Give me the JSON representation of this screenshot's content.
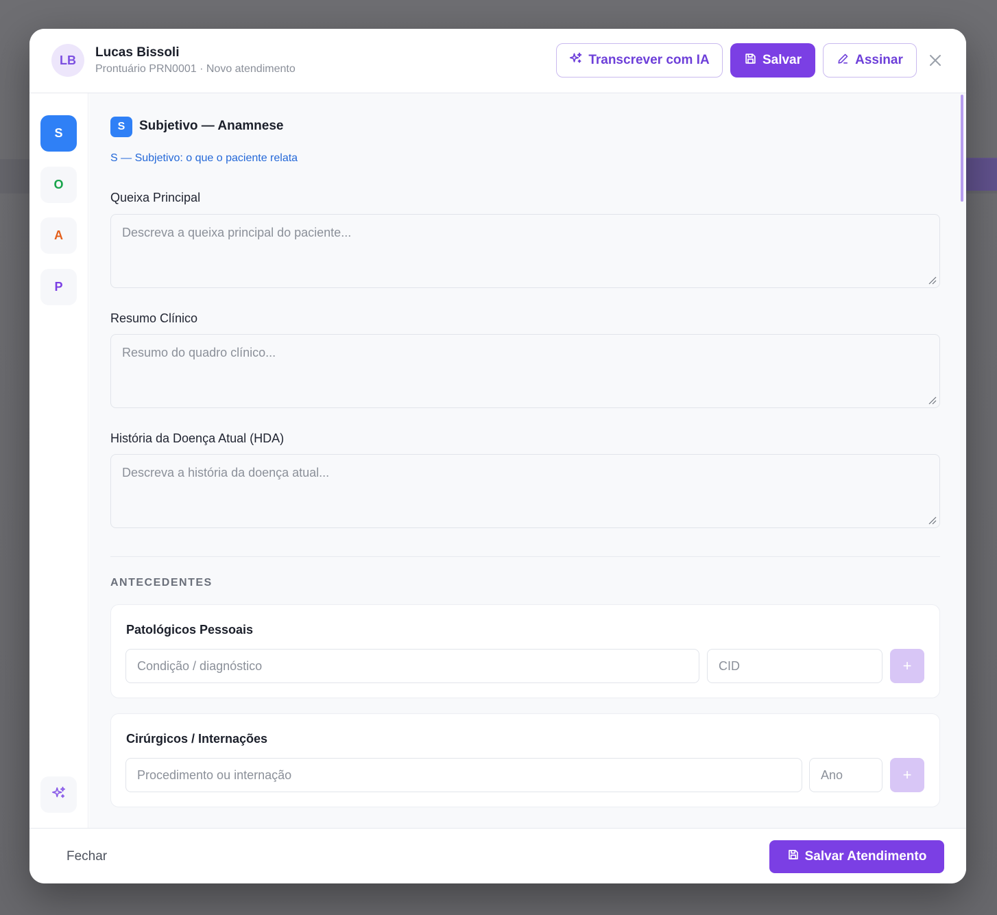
{
  "header": {
    "avatar_initials": "LB",
    "patient_name": "Lucas Bissoli",
    "record_id": "Prontuário PRN0001",
    "separator": " · ",
    "visit_type": "Novo atendimento",
    "transcribe_label": "Transcrever com IA",
    "save_label": "Salvar",
    "sign_label": "Assinar",
    "close_icon": "close-icon"
  },
  "sidebar": {
    "items": [
      {
        "label": "S",
        "color": "#2f80f6",
        "active": true
      },
      {
        "label": "O",
        "color": "#18a44b",
        "active": false
      },
      {
        "label": "A",
        "color": "#e4601d",
        "active": false
      },
      {
        "label": "P",
        "color": "#7b3fe4",
        "active": false
      }
    ],
    "ai_icon": "sparkles-icon"
  },
  "section": {
    "badge": "S",
    "title": "Subjetivo — Anamnese",
    "hint": "S — Subjetivo: o que o paciente relata",
    "fields": [
      {
        "label": "Queixa Principal",
        "placeholder": "Descreva a queixa principal do paciente..."
      },
      {
        "label": "Resumo Clínico",
        "placeholder": "Resumo do quadro clínico..."
      },
      {
        "label": "História da Doença Atual (HDA)",
        "placeholder": "Descreva a história da doença atual..."
      }
    ]
  },
  "antecedentes": {
    "heading": "ANTECEDENTES",
    "cards": [
      {
        "title": "Patológicos Pessoais",
        "input1_placeholder": "Condição / diagnóstico",
        "input2_placeholder": "CID",
        "add_label": "+"
      },
      {
        "title": "Cirúrgicos / Internações",
        "input1_placeholder": "Procedimento ou internação",
        "input2_placeholder": "Ano",
        "add_label": "+"
      }
    ]
  },
  "footer": {
    "close_label": "Fechar",
    "save_visit_label": "Salvar Atendimento"
  },
  "colors": {
    "accent": "#7b3fe4",
    "subjective_blue": "#2f80f6"
  }
}
